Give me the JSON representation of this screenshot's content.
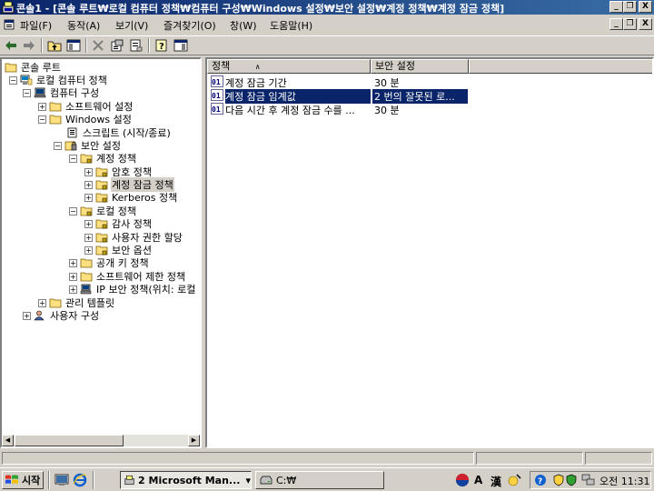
{
  "window": {
    "title": "콘솔1 - [콘솔 루트₩로컬 컴퓨터 정책₩컴퓨터 구성₩Windows 설정₩보안 설정₩계정 정책₩계정 잠금 정책]"
  },
  "window_buttons": {
    "minimize": "_",
    "restore": "❐",
    "close": "X"
  },
  "menu": [
    "파일(F)",
    "동작(A)",
    "보기(V)",
    "즐겨찾기(O)",
    "창(W)",
    "도움말(H)"
  ],
  "toolbar": [
    "back-arrow-icon",
    "forward-arrow-icon",
    "up-folder-icon",
    "show-tree-icon",
    "delete-icon",
    "properties-icon",
    "export-icon",
    "help-icon",
    "show-action-pane-icon"
  ],
  "tree": {
    "items": [
      {
        "label": "콘솔 루트",
        "expander": "",
        "icon": "folder-icon"
      },
      {
        "label": "로컬 컴퓨터 정책",
        "expander": "−",
        "icon": "policy-computer-icon"
      },
      {
        "label": "컴퓨터 구성",
        "expander": "−",
        "icon": "computer-icon"
      },
      {
        "label": "소프트웨어 설정",
        "expander": "+",
        "icon": "folder-icon"
      },
      {
        "label": "Windows 설정",
        "expander": "−",
        "icon": "folder-icon"
      },
      {
        "label": "스크립트 (시작/종료)",
        "expander": "",
        "icon": "script-icon"
      },
      {
        "label": "보안 설정",
        "expander": "−",
        "icon": "security-icon"
      },
      {
        "label": "계정 정책",
        "expander": "−",
        "icon": "folder-lock-icon"
      },
      {
        "label": "암호 정책",
        "expander": "+",
        "icon": "folder-lock-icon"
      },
      {
        "label": "계정 잠금 정책",
        "expander": "+",
        "icon": "folder-lock-icon"
      },
      {
        "label": "Kerberos 정책",
        "expander": "+",
        "icon": "folder-lock-icon"
      },
      {
        "label": "로컬 정책",
        "expander": "−",
        "icon": "folder-lock-icon"
      },
      {
        "label": "감사 정책",
        "expander": "+",
        "icon": "folder-lock-icon"
      },
      {
        "label": "사용자 권한 할당",
        "expander": "+",
        "icon": "folder-lock-icon"
      },
      {
        "label": "보안 옵션",
        "expander": "+",
        "icon": "folder-lock-icon"
      },
      {
        "label": "공개 키 정책",
        "expander": "+",
        "icon": "folder-icon"
      },
      {
        "label": "소프트웨어 제한 정책",
        "expander": "+",
        "icon": "folder-icon"
      },
      {
        "label": "IP 보안 정책(위치: 로컬",
        "expander": "+",
        "icon": "ip-security-icon"
      },
      {
        "label": "관리 템플릿",
        "expander": "+",
        "icon": "folder-icon"
      },
      {
        "label": "사용자 구성",
        "expander": "+",
        "icon": "user-icon"
      }
    ]
  },
  "list": {
    "columns": [
      "정책",
      "보안 설정"
    ],
    "sort_indicator": "∧",
    "rows": [
      {
        "policy": "계정 잠금 기간",
        "setting": "30 분",
        "selected": false
      },
      {
        "policy": "계정 잠금 임계값",
        "setting": "2 번의 잘못된 로...",
        "selected": true
      },
      {
        "policy": "다음 시간 후 계정 잠금 수를 ...",
        "setting": "30 분",
        "selected": false
      }
    ]
  },
  "taskbar": {
    "start_label": "시작",
    "tasks": [
      {
        "label": "2 Microsoft Man...",
        "dropdown": "▾"
      },
      {
        "label": "C:₩"
      }
    ],
    "tray": {
      "ime_a": "A",
      "ime_hanja": "漢",
      "clock": "오전 11:31"
    }
  },
  "colors": {
    "title_start": "#0a246a",
    "title_end": "#3a6ea5",
    "selection": "#0a246a",
    "chrome": "#d4d0c8"
  }
}
